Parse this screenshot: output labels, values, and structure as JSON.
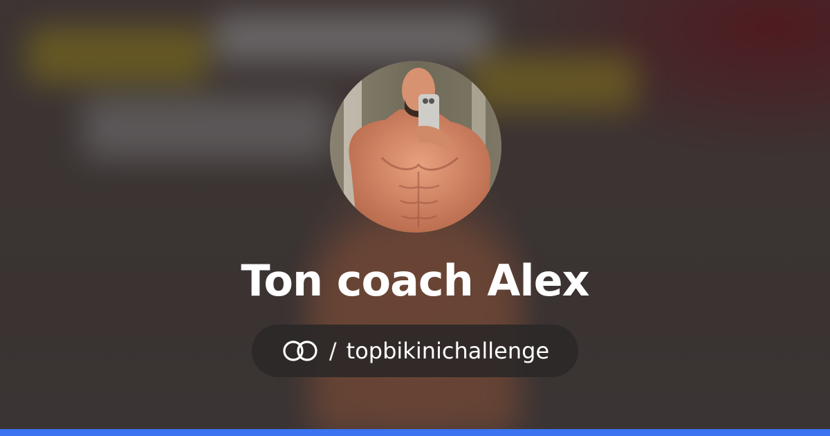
{
  "profile": {
    "display_name": "Ton coach Alex",
    "separator": "/",
    "username": "topbikinichallenge",
    "avatar_alt": "Ton coach Alex"
  },
  "icons": {
    "brand": "linked-rings-logo-icon"
  },
  "colors": {
    "accent_bar": "#3b73f0",
    "text": "#ffffff",
    "pill_background": "#2d2828"
  }
}
